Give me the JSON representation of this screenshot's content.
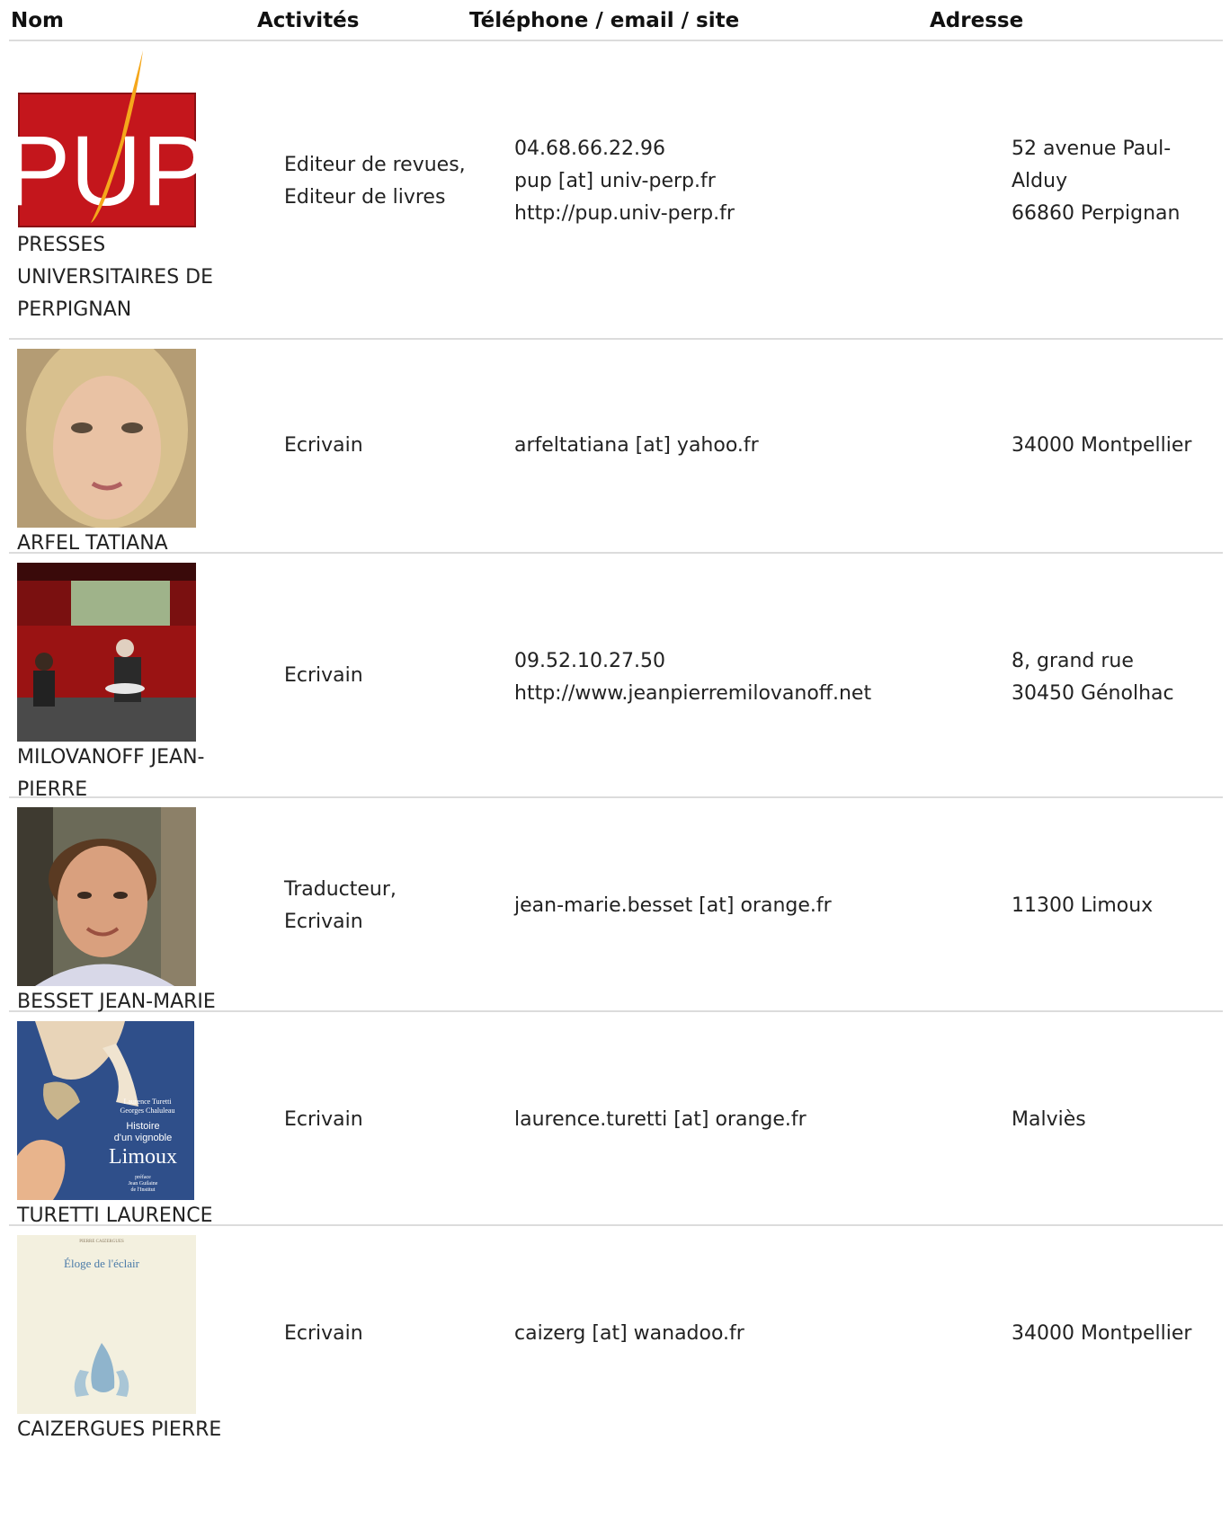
{
  "headers": {
    "name": "Nom",
    "activities": "Activités",
    "contact": "Téléphone / email / site",
    "address": "Adresse"
  },
  "entries": [
    {
      "name_lines": [
        "PRESSES",
        "UNIVERSITAIRES DE",
        "PERPIGNAN"
      ],
      "activities": [
        "Editeur de revues,",
        "Editeur de livres"
      ],
      "contact": [
        "04.68.66.22.96",
        "pup [at] univ-perp.fr",
        "http://pup.univ-perp.fr"
      ],
      "address": [
        "52 avenue Paul-",
        "Alduy",
        "66860 Perpignan"
      ],
      "image": "pup-logo",
      "logo_text": "PUP"
    },
    {
      "name_lines": [
        "ARFEL TATIANA"
      ],
      "activities": [
        "Ecrivain"
      ],
      "contact": [
        "arfeltatiana [at] yahoo.fr"
      ],
      "address": [
        "34000 Montpellier"
      ],
      "image": "portrait-woman"
    },
    {
      "name_lines": [
        "MILOVANOFF JEAN-",
        "PIERRE"
      ],
      "activities": [
        "Ecrivain"
      ],
      "contact": [
        "09.52.10.27.50",
        "http://www.jeanpierremilovanoff.net"
      ],
      "address": [
        "8, grand rue",
        "30450 Génolhac"
      ],
      "image": "stage-reading-photo"
    },
    {
      "name_lines": [
        "BESSET JEAN-MARIE"
      ],
      "activities": [
        "Traducteur,",
        "Ecrivain"
      ],
      "contact": [
        "jean-marie.besset [at] orange.fr"
      ],
      "address": [
        "11300 Limoux"
      ],
      "image": "portrait-man"
    },
    {
      "name_lines": [
        "TURETTI LAURENCE"
      ],
      "activities": [
        "Ecrivain"
      ],
      "contact": [
        "laurence.turetti [at] orange.fr"
      ],
      "address": [
        "Malviès"
      ],
      "image": "book-cover-limoux",
      "cover_lines": [
        "Laurence Turetti",
        "Georges Chaluleau",
        "Histoire",
        "d'un vignoble",
        "Limoux",
        "préface",
        "Jean Guilaine",
        "de l'Institut"
      ]
    },
    {
      "name_lines": [
        "CAIZERGUES PIERRE"
      ],
      "activities": [
        "Ecrivain"
      ],
      "contact": [
        "caizerg [at] wanadoo.fr"
      ],
      "address": [
        "34000 Montpellier"
      ],
      "image": "book-cover-eloge",
      "cover_lines": [
        "PIERRE CAIZERGUES",
        "Éloge de l'éclair"
      ]
    }
  ]
}
